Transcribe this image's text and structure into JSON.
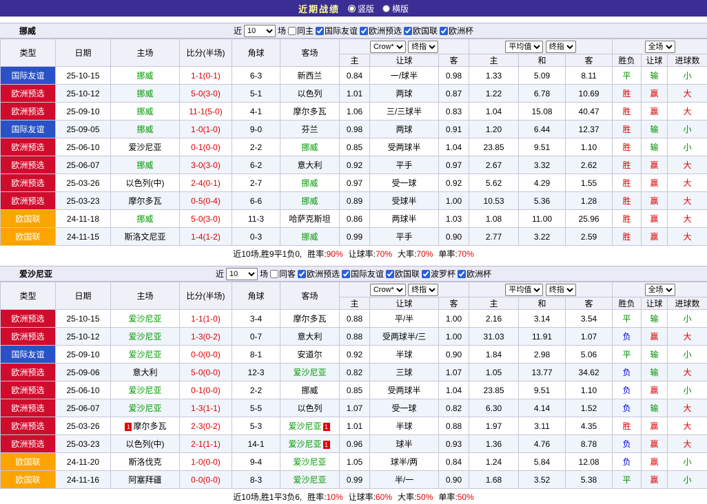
{
  "topbar": {
    "title": "近期战绩",
    "radios": [
      {
        "label": "竖版",
        "selected": true
      },
      {
        "label": "横版",
        "selected": false
      }
    ]
  },
  "filter_labels": {
    "near": "近",
    "games": "场"
  },
  "headers": {
    "type": "类型",
    "date": "日期",
    "home": "主场",
    "score": "比分(半场)",
    "corner": "角球",
    "away": "客场",
    "odds_select_1": "Crow*",
    "odds_select_2": "终指",
    "odds_home": "主",
    "odds_handicap": "让球",
    "odds_away": "客",
    "avg_select_1": "平均值",
    "avg_select_2": "终指",
    "avg_home": "主",
    "avg_draw": "和",
    "avg_away": "客",
    "scope_select": "全场",
    "result": "胜负",
    "handicap_result": "让球",
    "goals": "进球数"
  },
  "colors": {
    "topbar_bg": "#3a2d93",
    "topbar_title": "#ffff8c",
    "type_badges": {
      "国际友谊": "#2a52c6",
      "欧洲预选": "#d00c2d",
      "欧国联": "#fca400"
    },
    "result_text": {
      "胜": "#de0000",
      "赢": "#de0000",
      "大": "#de0000",
      "平": "#009000",
      "输": "#009000",
      "小": "#009000",
      "负": "#0000de"
    },
    "team_highlight": "#009900",
    "score": "#de0000"
  },
  "sections": [
    {
      "team": "挪威",
      "filter": {
        "count": "10",
        "same_label": "同主",
        "same_checked": false,
        "leagues": [
          {
            "label": "国际友谊",
            "checked": true
          },
          {
            "label": "欧洲预选",
            "checked": true
          },
          {
            "label": "欧国联",
            "checked": true
          },
          {
            "label": "欧洲杯",
            "checked": true
          }
        ]
      },
      "rows": [
        {
          "type": "国际友谊",
          "date": "25-10-15",
          "home": "挪威",
          "home_focus": true,
          "home_card": "",
          "score": "1-1(0-1)",
          "corner": "6-3",
          "away": "新西兰",
          "away_focus": false,
          "away_card": "",
          "odds_home": "0.84",
          "handicap": "一/球半",
          "odds_away": "0.98",
          "avg_home": "1.33",
          "avg_draw": "5.09",
          "avg_away": "8.11",
          "result": "平",
          "handicap_result": "输",
          "goals": "小"
        },
        {
          "type": "欧洲预选",
          "date": "25-10-12",
          "home": "挪威",
          "home_focus": true,
          "home_card": "",
          "score": "5-0(3-0)",
          "corner": "5-1",
          "away": "以色列",
          "away_focus": false,
          "away_card": "",
          "odds_home": "1.01",
          "handicap": "两球",
          "odds_away": "0.87",
          "avg_home": "1.22",
          "avg_draw": "6.78",
          "avg_away": "10.69",
          "result": "胜",
          "handicap_result": "赢",
          "goals": "大"
        },
        {
          "type": "欧洲预选",
          "date": "25-09-10",
          "home": "挪威",
          "home_focus": true,
          "home_card": "",
          "score": "11-1(5-0)",
          "corner": "4-1",
          "away": "摩尔多瓦",
          "away_focus": false,
          "away_card": "",
          "odds_home": "1.06",
          "handicap": "三/三球半",
          "odds_away": "0.83",
          "avg_home": "1.04",
          "avg_draw": "15.08",
          "avg_away": "40.47",
          "result": "胜",
          "handicap_result": "赢",
          "goals": "大"
        },
        {
          "type": "国际友谊",
          "date": "25-09-05",
          "home": "挪威",
          "home_focus": true,
          "home_card": "",
          "score": "1-0(1-0)",
          "corner": "9-0",
          "away": "芬兰",
          "away_focus": false,
          "away_card": "",
          "odds_home": "0.98",
          "handicap": "两球",
          "odds_away": "0.91",
          "avg_home": "1.20",
          "avg_draw": "6.44",
          "avg_away": "12.37",
          "result": "胜",
          "handicap_result": "输",
          "goals": "小"
        },
        {
          "type": "欧洲预选",
          "date": "25-06-10",
          "home": "爱沙尼亚",
          "home_focus": false,
          "home_card": "",
          "score": "0-1(0-0)",
          "corner": "2-2",
          "away": "挪威",
          "away_focus": true,
          "away_card": "",
          "odds_home": "0.85",
          "handicap": "受两球半",
          "odds_away": "1.04",
          "avg_home": "23.85",
          "avg_draw": "9.51",
          "avg_away": "1.10",
          "result": "胜",
          "handicap_result": "输",
          "goals": "小"
        },
        {
          "type": "欧洲预选",
          "date": "25-06-07",
          "home": "挪威",
          "home_focus": true,
          "home_card": "",
          "score": "3-0(3-0)",
          "corner": "6-2",
          "away": "意大利",
          "away_focus": false,
          "away_card": "",
          "odds_home": "0.92",
          "handicap": "平手",
          "odds_away": "0.97",
          "avg_home": "2.67",
          "avg_draw": "3.32",
          "avg_away": "2.62",
          "result": "胜",
          "handicap_result": "赢",
          "goals": "大"
        },
        {
          "type": "欧洲预选",
          "date": "25-03-26",
          "home": "以色列(中)",
          "home_focus": false,
          "home_card": "",
          "score": "2-4(0-1)",
          "corner": "2-7",
          "away": "挪威",
          "away_focus": true,
          "away_card": "",
          "odds_home": "0.97",
          "handicap": "受一球",
          "odds_away": "0.92",
          "avg_home": "5.62",
          "avg_draw": "4.29",
          "avg_away": "1.55",
          "result": "胜",
          "handicap_result": "赢",
          "goals": "大"
        },
        {
          "type": "欧洲预选",
          "date": "25-03-23",
          "home": "摩尔多瓦",
          "home_focus": false,
          "home_card": "",
          "score": "0-5(0-4)",
          "corner": "6-6",
          "away": "挪威",
          "away_focus": true,
          "away_card": "",
          "odds_home": "0.89",
          "handicap": "受球半",
          "odds_away": "1.00",
          "avg_home": "10.53",
          "avg_draw": "5.36",
          "avg_away": "1.28",
          "result": "胜",
          "handicap_result": "赢",
          "goals": "大"
        },
        {
          "type": "欧国联",
          "date": "24-11-18",
          "home": "挪威",
          "home_focus": true,
          "home_card": "",
          "score": "5-0(3-0)",
          "corner": "11-3",
          "away": "哈萨克斯坦",
          "away_focus": false,
          "away_card": "",
          "odds_home": "0.86",
          "handicap": "两球半",
          "odds_away": "1.03",
          "avg_home": "1.08",
          "avg_draw": "11.00",
          "avg_away": "25.96",
          "result": "胜",
          "handicap_result": "赢",
          "goals": "大"
        },
        {
          "type": "欧国联",
          "date": "24-11-15",
          "home": "斯洛文尼亚",
          "home_focus": false,
          "home_card": "",
          "score": "1-4(1-2)",
          "corner": "0-3",
          "away": "挪威",
          "away_focus": true,
          "away_card": "",
          "odds_home": "0.99",
          "handicap": "平手",
          "odds_away": "0.90",
          "avg_home": "2.77",
          "avg_draw": "3.22",
          "avg_away": "2.59",
          "result": "胜",
          "handicap_result": "赢",
          "goals": "大"
        }
      ],
      "summary": {
        "prefix": "近10场,胜9平1负0,",
        "stats": [
          {
            "label": "胜率:",
            "value": "90%"
          },
          {
            "label": "让球率:",
            "value": "70%"
          },
          {
            "label": "大率:",
            "value": "70%"
          },
          {
            "label": "单率:",
            "value": "70%"
          }
        ]
      }
    },
    {
      "team": "爱沙尼亚",
      "filter": {
        "count": "10",
        "same_label": "同客",
        "same_checked": false,
        "leagues": [
          {
            "label": "欧洲预选",
            "checked": true
          },
          {
            "label": "国际友谊",
            "checked": true
          },
          {
            "label": "欧国联",
            "checked": true
          },
          {
            "label": "波罗杯",
            "checked": true
          },
          {
            "label": "欧洲杯",
            "checked": true
          }
        ]
      },
      "rows": [
        {
          "type": "欧洲预选",
          "date": "25-10-15",
          "home": "爱沙尼亚",
          "home_focus": true,
          "home_card": "",
          "score": "1-1(1-0)",
          "corner": "3-4",
          "away": "摩尔多瓦",
          "away_focus": false,
          "away_card": "",
          "odds_home": "0.88",
          "handicap": "平/半",
          "odds_away": "1.00",
          "avg_home": "2.16",
          "avg_draw": "3.14",
          "avg_away": "3.54",
          "result": "平",
          "handicap_result": "输",
          "goals": "小"
        },
        {
          "type": "欧洲预选",
          "date": "25-10-12",
          "home": "爱沙尼亚",
          "home_focus": true,
          "home_card": "",
          "score": "1-3(0-2)",
          "corner": "0-7",
          "away": "意大利",
          "away_focus": false,
          "away_card": "",
          "odds_home": "0.88",
          "handicap": "受两球半/三",
          "odds_away": "1.00",
          "avg_home": "31.03",
          "avg_draw": "11.91",
          "avg_away": "1.07",
          "result": "负",
          "handicap_result": "赢",
          "goals": "大"
        },
        {
          "type": "国际友谊",
          "date": "25-09-10",
          "home": "爱沙尼亚",
          "home_focus": true,
          "home_card": "",
          "score": "0-0(0-0)",
          "corner": "8-1",
          "away": "安道尔",
          "away_focus": false,
          "away_card": "",
          "odds_home": "0.92",
          "handicap": "半球",
          "odds_away": "0.90",
          "avg_home": "1.84",
          "avg_draw": "2.98",
          "avg_away": "5.06",
          "result": "平",
          "handicap_result": "输",
          "goals": "小"
        },
        {
          "type": "欧洲预选",
          "date": "25-09-06",
          "home": "意大利",
          "home_focus": false,
          "home_card": "",
          "score": "5-0(0-0)",
          "corner": "12-3",
          "away": "爱沙尼亚",
          "away_focus": true,
          "away_card": "",
          "odds_home": "0.82",
          "handicap": "三球",
          "odds_away": "1.07",
          "avg_home": "1.05",
          "avg_draw": "13.77",
          "avg_away": "34.62",
          "result": "负",
          "handicap_result": "输",
          "goals": "大"
        },
        {
          "type": "欧洲预选",
          "date": "25-06-10",
          "home": "爱沙尼亚",
          "home_focus": true,
          "home_card": "",
          "score": "0-1(0-0)",
          "corner": "2-2",
          "away": "挪威",
          "away_focus": false,
          "away_card": "",
          "odds_home": "0.85",
          "handicap": "受两球半",
          "odds_away": "1.04",
          "avg_home": "23.85",
          "avg_draw": "9.51",
          "avg_away": "1.10",
          "result": "负",
          "handicap_result": "赢",
          "goals": "小"
        },
        {
          "type": "欧洲预选",
          "date": "25-06-07",
          "home": "爱沙尼亚",
          "home_focus": true,
          "home_card": "",
          "score": "1-3(1-1)",
          "corner": "5-5",
          "away": "以色列",
          "away_focus": false,
          "away_card": "",
          "odds_home": "1.07",
          "handicap": "受一球",
          "odds_away": "0.82",
          "avg_home": "6.30",
          "avg_draw": "4.14",
          "avg_away": "1.52",
          "result": "负",
          "handicap_result": "输",
          "goals": "大"
        },
        {
          "type": "欧洲预选",
          "date": "25-03-26",
          "home": "摩尔多瓦",
          "home_focus": false,
          "home_card": "1",
          "score": "2-3(0-2)",
          "corner": "5-3",
          "away": "爱沙尼亚",
          "away_focus": true,
          "away_card": "1",
          "odds_home": "1.01",
          "handicap": "半球",
          "odds_away": "0.88",
          "avg_home": "1.97",
          "avg_draw": "3.11",
          "avg_away": "4.35",
          "result": "胜",
          "handicap_result": "赢",
          "goals": "大"
        },
        {
          "type": "欧洲预选",
          "date": "25-03-23",
          "home": "以色列(中)",
          "home_focus": false,
          "home_card": "",
          "score": "2-1(1-1)",
          "corner": "14-1",
          "away": "爱沙尼亚",
          "away_focus": true,
          "away_card": "1",
          "odds_home": "0.96",
          "handicap": "球半",
          "odds_away": "0.93",
          "avg_home": "1.36",
          "avg_draw": "4.76",
          "avg_away": "8.78",
          "result": "负",
          "handicap_result": "赢",
          "goals": "大"
        },
        {
          "type": "欧国联",
          "date": "24-11-20",
          "home": "斯洛伐克",
          "home_focus": false,
          "home_card": "",
          "score": "1-0(0-0)",
          "corner": "9-4",
          "away": "爱沙尼亚",
          "away_focus": true,
          "away_card": "",
          "odds_home": "1.05",
          "handicap": "球半/两",
          "odds_away": "0.84",
          "avg_home": "1.24",
          "avg_draw": "5.84",
          "avg_away": "12.08",
          "result": "负",
          "handicap_result": "赢",
          "goals": "小"
        },
        {
          "type": "欧国联",
          "date": "24-11-16",
          "home": "阿塞拜疆",
          "home_focus": false,
          "home_card": "",
          "score": "0-0(0-0)",
          "corner": "8-3",
          "away": "爱沙尼亚",
          "away_focus": true,
          "away_card": "",
          "odds_home": "0.99",
          "handicap": "半/一",
          "odds_away": "0.90",
          "avg_home": "1.68",
          "avg_draw": "3.52",
          "avg_away": "5.38",
          "result": "平",
          "handicap_result": "赢",
          "goals": "小"
        }
      ],
      "summary": {
        "prefix": "近10场,胜1平3负6,",
        "stats": [
          {
            "label": "胜率:",
            "value": "10%"
          },
          {
            "label": "让球率:",
            "value": "60%"
          },
          {
            "label": "大率:",
            "value": "50%"
          },
          {
            "label": "单率:",
            "value": "50%"
          }
        ]
      }
    }
  ]
}
